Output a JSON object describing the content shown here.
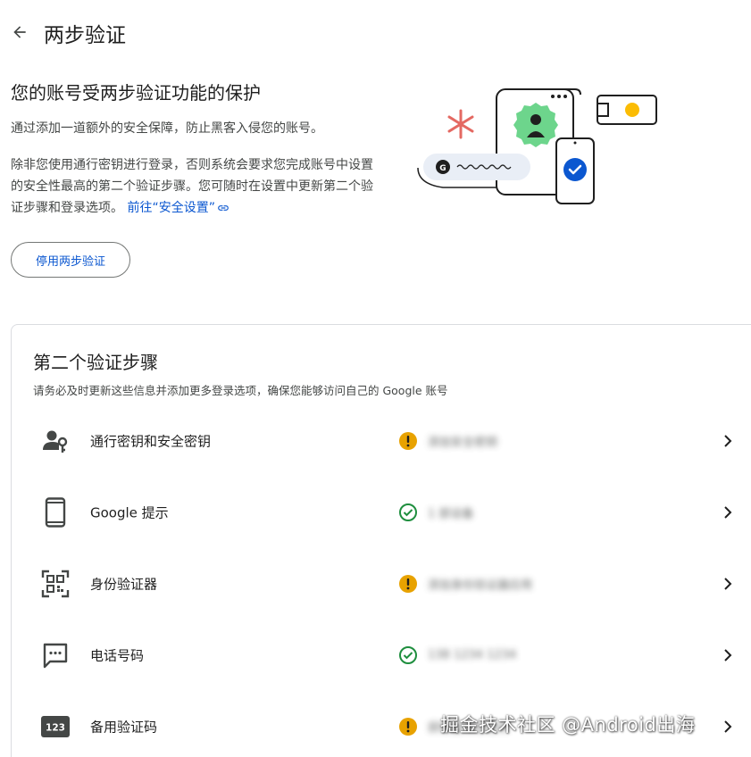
{
  "header": {
    "title": "两步验证"
  },
  "hero": {
    "title": "您的账号受两步验证功能的保护",
    "paragraph1": "通过添加一道额外的安全保障，防止黑客入侵您的账号。",
    "paragraph2": "除非您使用通行密钥进行登录，否则系统会要求您完成账号中设置的安全性最高的第二个验证步骤。您可随时在设置中更新第二个验证步骤和登录选项。",
    "link_text": "前往“安全设置”",
    "disable_button": "停用两步验证"
  },
  "second_step": {
    "title": "第二个验证步骤",
    "subtitle": "请务必及时更新这些信息并添加更多登录选项，确保您能够访问自己的 Google 账号",
    "items": [
      {
        "label": "通行密钥和安全密钥",
        "status": "添加安全密钥",
        "status_type": "warning",
        "icon": "passkey-icon"
      },
      {
        "label": "Google 提示",
        "status": "1 部设备",
        "status_type": "ok",
        "icon": "phone-icon"
      },
      {
        "label": "身份验证器",
        "status": "添加身份验证器应用",
        "status_type": "warning",
        "icon": "qr-code-icon"
      },
      {
        "label": "电话号码",
        "status": "138 1234 1234",
        "status_type": "ok",
        "icon": "message-icon"
      },
      {
        "label": "备用验证码",
        "status": "获取备用验证码",
        "status_type": "warning",
        "icon": "backup-codes-icon"
      }
    ]
  },
  "watermark": "掘金技术社区 @Android出海",
  "colors": {
    "accent": "#0b57d0",
    "warning": "#e8a200",
    "ok": "#1e8e3e",
    "text": "#1f1f1f",
    "muted": "#444746"
  }
}
